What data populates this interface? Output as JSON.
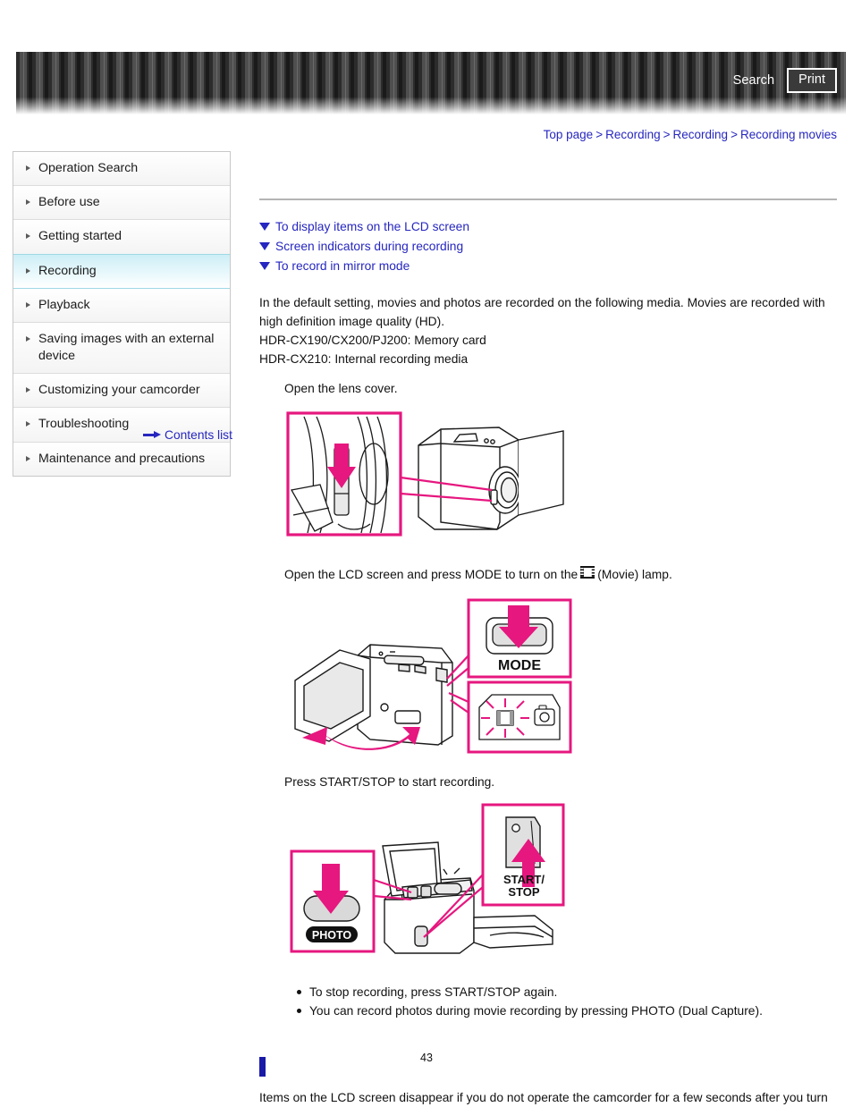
{
  "header": {
    "search_label": "Search",
    "print_label": "Print",
    "search_icon": "search-icon",
    "print_icon": "printer-icon"
  },
  "breadcrumb": {
    "separator": ">",
    "items": [
      {
        "label": "Top page"
      },
      {
        "label": "Recording"
      },
      {
        "label": "Recording"
      },
      {
        "label": "Recording movies"
      }
    ]
  },
  "sidebar": {
    "items": [
      {
        "label": "Operation Search",
        "active": false
      },
      {
        "label": "Before use",
        "active": false
      },
      {
        "label": "Getting started",
        "active": false
      },
      {
        "label": "Recording",
        "active": true
      },
      {
        "label": "Playback",
        "active": false
      },
      {
        "label": "Saving images with an external device",
        "active": false
      },
      {
        "label": "Customizing your camcorder",
        "active": false
      },
      {
        "label": "Troubleshooting",
        "active": false
      },
      {
        "label": "Maintenance and precautions",
        "active": false
      }
    ],
    "contents_list_label": "Contents list",
    "contents_list_icon": "arrow-right-icon",
    "active_highlight_color": "#cdeef6"
  },
  "main": {
    "anchors": [
      {
        "label": "To display items on the LCD screen",
        "icon": "triangle-down-icon"
      },
      {
        "label": "Screen indicators during recording",
        "icon": "triangle-down-icon"
      },
      {
        "label": "To record in mirror mode",
        "icon": "triangle-down-icon"
      }
    ],
    "intro": {
      "line1": "In the default setting, movies and photos are recorded on the following media. Movies are recorded with",
      "line2": "high definition image quality (HD).",
      "line3": "HDR-CX190/CX200/PJ200: Memory card",
      "line4": "HDR-CX210: Internal recording media"
    },
    "steps": [
      {
        "text": "Open the lens cover.",
        "figure": "camcorder-lens-cover-diagram"
      },
      {
        "text_before": "Open the LCD screen and press MODE to turn on the",
        "icon": "movie-film-icon",
        "text_after": "(Movie) lamp.",
        "figure": "camcorder-mode-button-diagram",
        "callout_label": "MODE"
      },
      {
        "text": "Press START/STOP to start recording.",
        "figure": "camcorder-start-stop-diagram",
        "callout_label_1": "START/",
        "callout_label_2": "STOP",
        "callout_label_3": "PHOTO"
      }
    ],
    "bullets": [
      "To stop recording, press START/STOP again.",
      "You can record photos during movie recording by pressing PHOTO (Dual Capture)."
    ],
    "closing_text": "Items on the LCD screen disappear if you do not operate the camcorder for a few seconds after you turn",
    "marker_color": "#1a1aa8"
  },
  "footer": {
    "page_number": "43"
  }
}
